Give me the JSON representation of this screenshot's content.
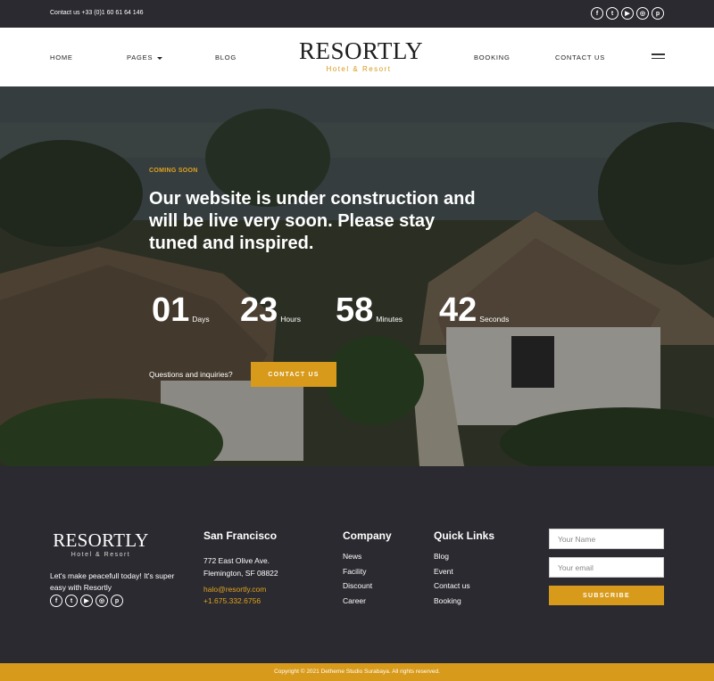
{
  "topbar": {
    "contact": "Contact us +33 (0)1 60 61 64 146",
    "social_icons": [
      "facebook-icon",
      "twitter-icon",
      "youtube-icon",
      "instagram-icon",
      "pinterest-icon"
    ],
    "social_glyphs": [
      "f",
      "t",
      "▶",
      "◎",
      "p"
    ]
  },
  "nav": {
    "home": "HOME",
    "pages": "PAGES",
    "blog": "BLOG",
    "booking": "BOOKING",
    "contact": "CONTACT US"
  },
  "brand": {
    "name": "RESORTLY",
    "tagline": "Hotel & Resort"
  },
  "hero": {
    "kicker": "COMING SOON",
    "headline": "Our website is under construction and will be live very soon. Please stay tuned and inspired.",
    "countdown": [
      {
        "value": "01",
        "unit": "Days"
      },
      {
        "value": "23",
        "unit": "Hours"
      },
      {
        "value": "58",
        "unit": "Minutes"
      },
      {
        "value": "42",
        "unit": "Seconds"
      }
    ],
    "question": "Questions and inquiries?",
    "cta": "CONTACT US"
  },
  "footer": {
    "description": "Let's make peacefull today! It's super easy with Resortly",
    "location": {
      "title": "San Francisco",
      "address_line1": "772 East Olive Ave.",
      "address_line2": "Flemington, SF 08822",
      "email": "halo@resortly.com",
      "phone": "+1.675.332.6756"
    },
    "company": {
      "title": "Company",
      "links": [
        "News",
        "Facility",
        "Discount",
        "Career"
      ]
    },
    "quick_links": {
      "title": "Quick Links",
      "links": [
        "Blog",
        "Event",
        "Contact us",
        "Booking"
      ]
    },
    "newsletter": {
      "name_placeholder": "Your Name",
      "email_placeholder": "Your email",
      "button": "SUBSCRIBE"
    },
    "copyright": "Copyright © 2021 Detheme Studio Surabaya. All rights reserved."
  },
  "colors": {
    "accent": "#d89a1a",
    "dark": "#2a2a30"
  }
}
